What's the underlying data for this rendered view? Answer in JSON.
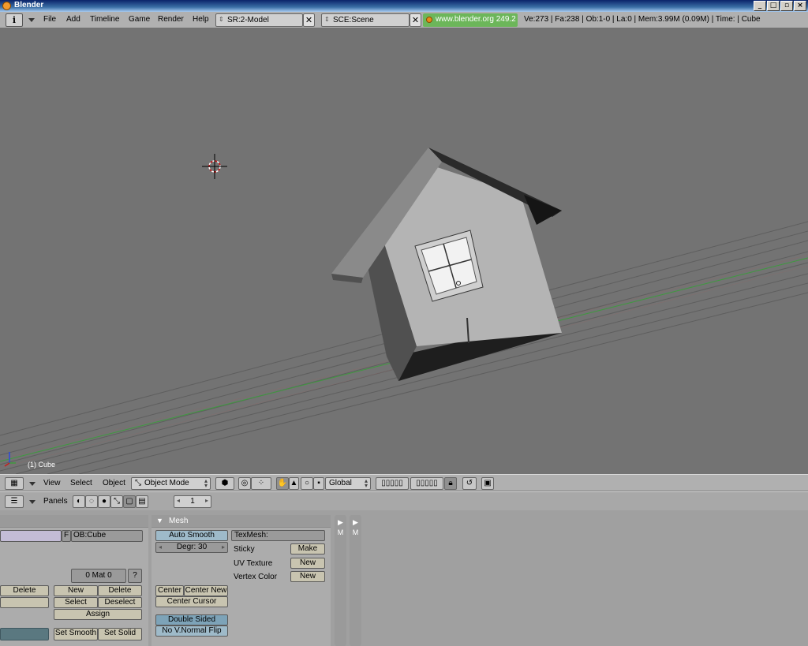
{
  "window": {
    "title": "Blender"
  },
  "info_header": {
    "menus": [
      "File",
      "Add",
      "Timeline",
      "Game",
      "Render",
      "Help"
    ],
    "screen": "SR:2-Model",
    "scene": "SCE:Scene",
    "version_link": "www.blender.org 249.2",
    "stats": "Ve:273 | Fa:238 | Ob:1-0 | La:0  | Mem:3.99M (0.09M) | Time: | Cube"
  },
  "viewport": {
    "object_label": "(1) Cube"
  },
  "view3d_header": {
    "menus": [
      "View",
      "Select",
      "Object"
    ],
    "mode": "Object Mode",
    "orientation": "Global"
  },
  "buttons_header": {
    "panels_label": "Panels",
    "frame": "1"
  },
  "link_materials": {
    "f_label": "F",
    "object_name": "OB:Cube",
    "mat_counter": "0 Mat 0",
    "mat_help": "?",
    "delete_left": "Delete",
    "new": "New",
    "delete": "Delete",
    "select": "Select",
    "deselect": "Deselect",
    "assign": "Assign",
    "set_smooth": "Set Smooth",
    "set_solid": "Set Solid"
  },
  "mesh_panel": {
    "title": "Mesh",
    "auto_smooth": "Auto Smooth",
    "degr": "Degr: 30",
    "texmesh": "TexMesh:",
    "sticky": "Sticky",
    "sticky_btn": "Make",
    "uv_texture": "UV Texture",
    "uv_btn": "New",
    "vertex_color": "Vertex Color",
    "vc_btn": "New",
    "center": "Center",
    "center_new": "Center New",
    "center_cursor": "Center Cursor",
    "double_sided": "Double Sided",
    "no_vnormal_flip": "No V.Normal Flip"
  },
  "side_strips": [
    "M",
    "M"
  ]
}
